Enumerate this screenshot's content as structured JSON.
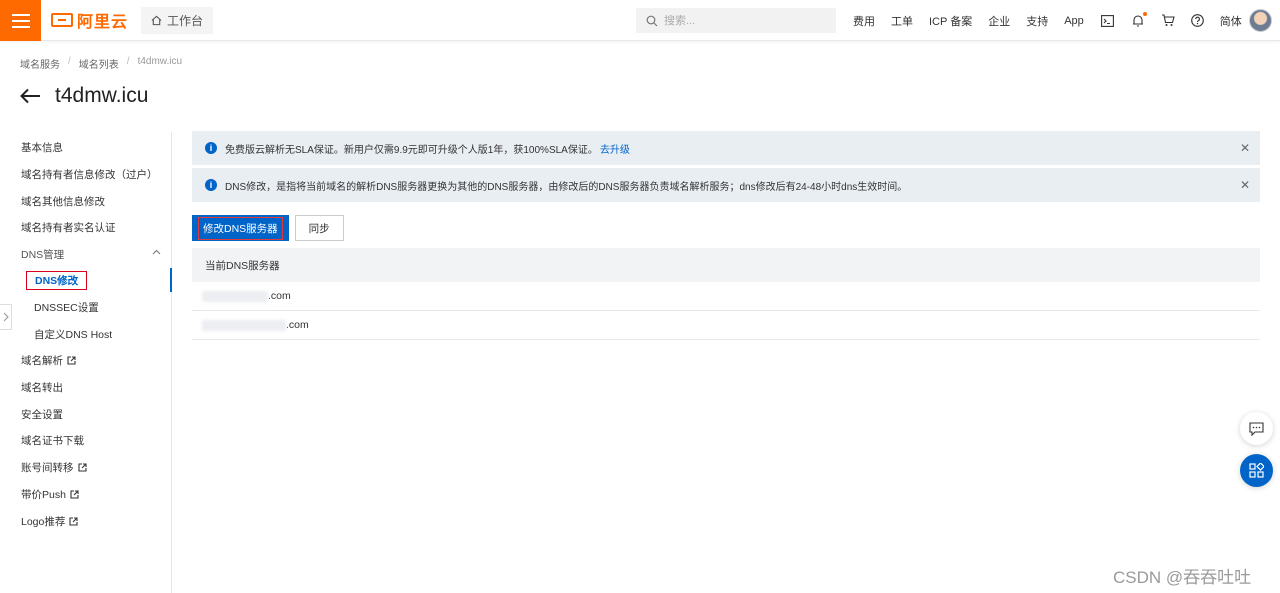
{
  "header": {
    "logo_text": "阿里云",
    "workbench_label": "工作台",
    "search_placeholder": "搜索...",
    "nav": [
      "费用",
      "工单",
      "ICP 备案",
      "企业",
      "支持",
      "App"
    ],
    "lang_label": "简体",
    "brand_color": "#ff6a00"
  },
  "breadcrumb": [
    "域名服务",
    "域名列表",
    "t4dmw.icu"
  ],
  "page_title": "t4dmw.icu",
  "sidebar": {
    "items": [
      {
        "label": "基本信息"
      },
      {
        "label": "域名持有者信息修改（过户）"
      },
      {
        "label": "域名其他信息修改"
      },
      {
        "label": "域名持有者实名认证"
      },
      {
        "label": "DNS管理"
      },
      {
        "label": "DNS修改",
        "active": true
      },
      {
        "label": "DNSSEC设置"
      },
      {
        "label": "自定义DNS Host"
      },
      {
        "label": "域名解析",
        "external": true
      },
      {
        "label": "域名转出"
      },
      {
        "label": "安全设置"
      },
      {
        "label": "域名证书下载"
      },
      {
        "label": "账号间转移",
        "external": true
      },
      {
        "label": "带价Push",
        "external": true
      },
      {
        "label": "Logo推荐",
        "external": true
      }
    ]
  },
  "alerts": [
    {
      "text": "免费版云解析无SLA保证。新用户仅需9.9元即可升级个人版1年，获100%SLA保证。",
      "link": "去升级"
    },
    {
      "text": "DNS修改，是指将当前域名的解析DNS服务器更换为其他的DNS服务器，由修改后的DNS服务器负责域名解析服务；dns修改后有24-48小时dns生效时间。",
      "link": ""
    }
  ],
  "buttons": {
    "modify_dns": "修改DNS服务器",
    "sync": "同步"
  },
  "table": {
    "header": "当前DNS服务器",
    "rows": [
      ".com",
      ".com"
    ]
  },
  "watermark": "CSDN @吞吞吐吐",
  "accent_color": "#0064c8"
}
